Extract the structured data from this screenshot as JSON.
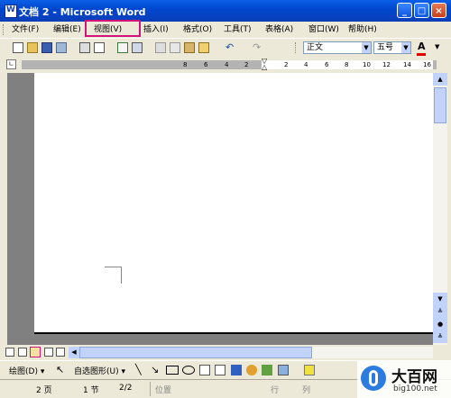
{
  "window": {
    "title": "文档 2 - Microsoft Word"
  },
  "menu": {
    "file": "文件(F)",
    "edit": "编辑(E)",
    "view": "视图(V)",
    "insert": "插入(I)",
    "format": "格式(O)",
    "tools": "工具(T)",
    "table": "表格(A)",
    "window": "窗口(W)",
    "help": "帮助(H)"
  },
  "format_toolbar": {
    "style": "正文",
    "size": "五号",
    "font_color_label": "A"
  },
  "ruler": {
    "numbers": [
      "8",
      "6",
      "4",
      "2",
      "2",
      "4",
      "6",
      "8",
      "10",
      "12",
      "14",
      "16"
    ]
  },
  "drawing_toolbar": {
    "draw_label": "绘图(D)",
    "autoshapes_label": "自选图形(U)"
  },
  "status": {
    "page": "2 页",
    "section": "1 节",
    "pages": "2/2",
    "position": "位置",
    "line": "行",
    "column": "列"
  },
  "watermark": {
    "brand": "大百网",
    "url": "big100.net"
  }
}
